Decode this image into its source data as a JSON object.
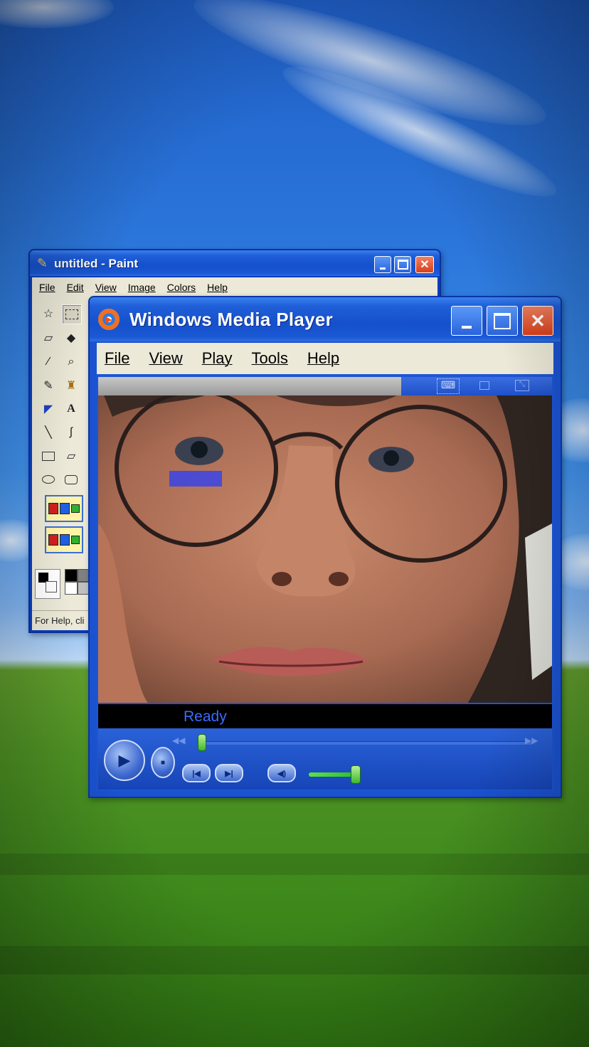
{
  "paint": {
    "title": "untitled - Paint",
    "menu": [
      "File",
      "Edit",
      "View",
      "Image",
      "Colors",
      "Help"
    ],
    "status": "For Help, cli"
  },
  "wmp": {
    "title": "Windows Media Player",
    "menu": [
      "File",
      "View",
      "Play",
      "Tools",
      "Help"
    ],
    "status": "Ready",
    "seek_position": 0.0,
    "volume": 0.9
  }
}
